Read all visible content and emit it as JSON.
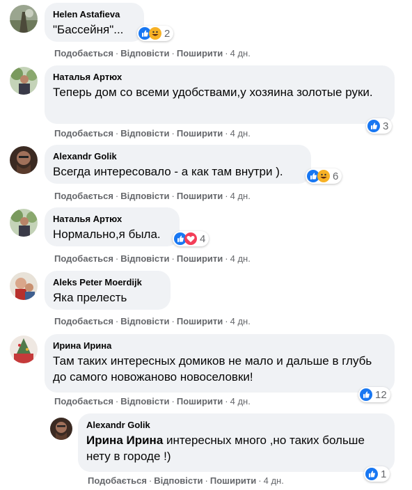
{
  "actions": {
    "like": "Подобається",
    "reply": "Відповісти",
    "share": "Поширити",
    "separator": "·"
  },
  "comments": [
    {
      "author": "Helen Astafieva",
      "text": "\"Бассейня\"...",
      "time": "4 дн.",
      "reaction_count": "2",
      "reactions": [
        "like-icon",
        "haha-icon"
      ]
    },
    {
      "author": "Наталья Артюх",
      "text": "Теперь дом со всеми удобствами,у хозяина золотые руки.",
      "time": "4 дн.",
      "reaction_count": "3",
      "reactions": [
        "like-icon"
      ]
    },
    {
      "author": "Alexandr Golik",
      "text": "Всегда интересовало - а как там внутри ).",
      "time": "4 дн.",
      "reaction_count": "6",
      "reactions": [
        "like-icon",
        "haha-icon"
      ]
    },
    {
      "author": "Наталья Артюх",
      "text": "Нормально,я была.",
      "time": "4 дн.",
      "reaction_count": "4",
      "reactions": [
        "like-icon",
        "love-icon"
      ]
    },
    {
      "author": "Aleks Peter Moerdijk",
      "text": "Яка прелесть",
      "time": "4 дн."
    },
    {
      "author": "Ирина Ирина",
      "text": "Там таких интересных домиков не мало и дальше в глубь до самого новожаново новоселовки!",
      "time": "4 дн.",
      "reaction_count": "12",
      "reactions": [
        "like-icon"
      ]
    },
    {
      "author": "Alexandr Golik",
      "mention": "Ирина Ирина",
      "text": " интересных много ,но таких больше нету в городе !)",
      "time": "4 дн.",
      "reaction_count": "1",
      "reactions": [
        "like-icon"
      ]
    }
  ],
  "colors": {
    "bubble": "#f0f2f5",
    "meta_text": "#65676b",
    "like_blue": "#1877f2",
    "love_red": "#f33e58",
    "haha_yellow": "#f7b125"
  }
}
